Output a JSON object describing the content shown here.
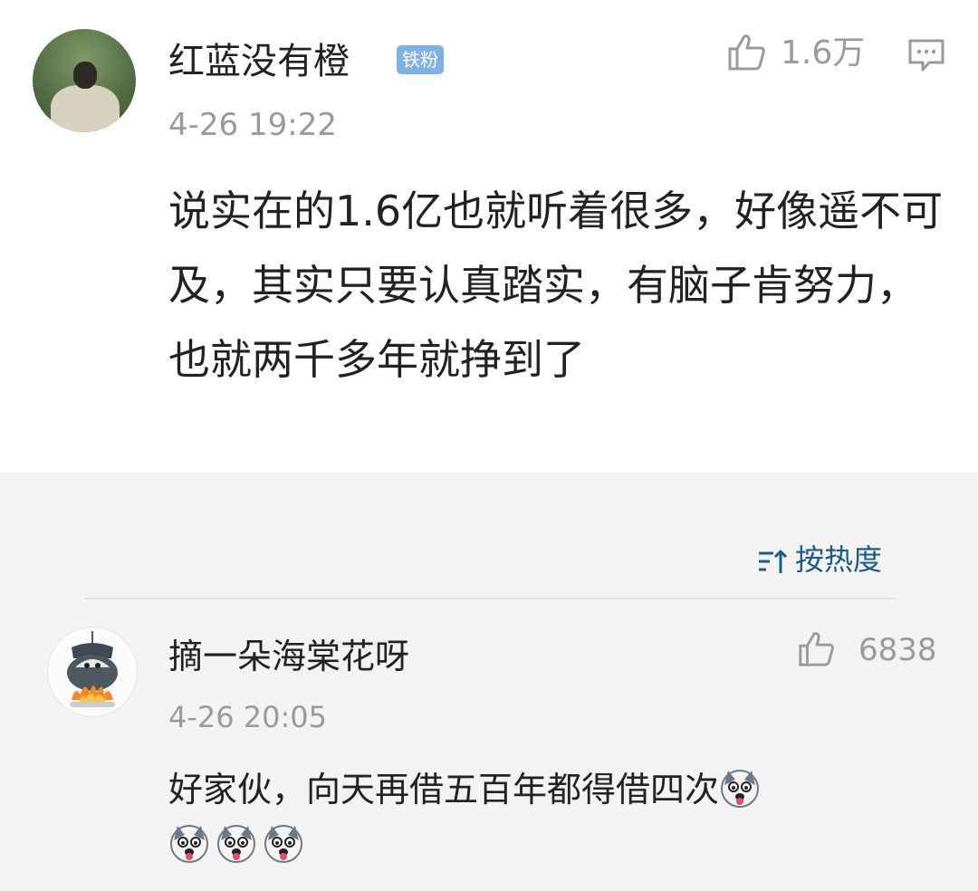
{
  "post": {
    "author": "红蓝没有橙",
    "badge": "铁粉",
    "time": "4-26 19:22",
    "likes": "1.6万",
    "text": "说实在的1.6亿也就听着很多，好像遥不可及，其实只要认真踏实，有脑子肯努力，也就两千多年就挣到了",
    "icons": {
      "like": "thumbs-up-icon",
      "comment": "comment-icon"
    }
  },
  "toolbar": {
    "sort_label": "按热度",
    "sort_icon": "sort-icon"
  },
  "reply": {
    "author": "摘一朵海棠花呀",
    "time": "4-26 20:05",
    "likes": "6838",
    "text": "好家伙，向天再借五百年都得借四次",
    "emojis": [
      "husky-emoji",
      "husky-emoji",
      "husky-emoji",
      "husky-emoji"
    ]
  },
  "colors": {
    "accent": "#1d5a86",
    "badge": "#7fb2e0",
    "muted": "#9a9a9a",
    "background": "#f3f3f3"
  }
}
